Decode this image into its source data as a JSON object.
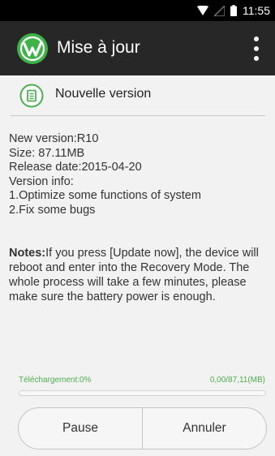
{
  "status_bar": {
    "time": "11:55",
    "icons": [
      "wifi-icon",
      "signal-icon",
      "battery-icon"
    ]
  },
  "app_bar": {
    "title": "Mise à jour",
    "logo": "app-logo-icon",
    "menu_icon": "overflow-menu-icon",
    "background": "#272727"
  },
  "header": {
    "icon": "document-icon",
    "title": "Nouvelle version",
    "accent": "#4caf50"
  },
  "version_info": {
    "version": "New version:R10",
    "size": "Size: 87.11MB",
    "release_date": "Release date:2015-04-20",
    "info_label": "Version info:",
    "item_1": "1.Optimize some functions of system",
    "item_2": "2.Fix some bugs"
  },
  "notes": {
    "label": "Notes:",
    "text": "If you press [Update now], the device will reboot and enter into the Recovery Mode. The whole process will take a few minutes, please make sure the battery power is enough."
  },
  "download": {
    "label": "Téléchargement:0%",
    "size": "0,00/87,11(MB)",
    "progress_percent": 0,
    "color": "#4caf50"
  },
  "buttons": {
    "pause": "Pause",
    "cancel": "Annuler"
  }
}
